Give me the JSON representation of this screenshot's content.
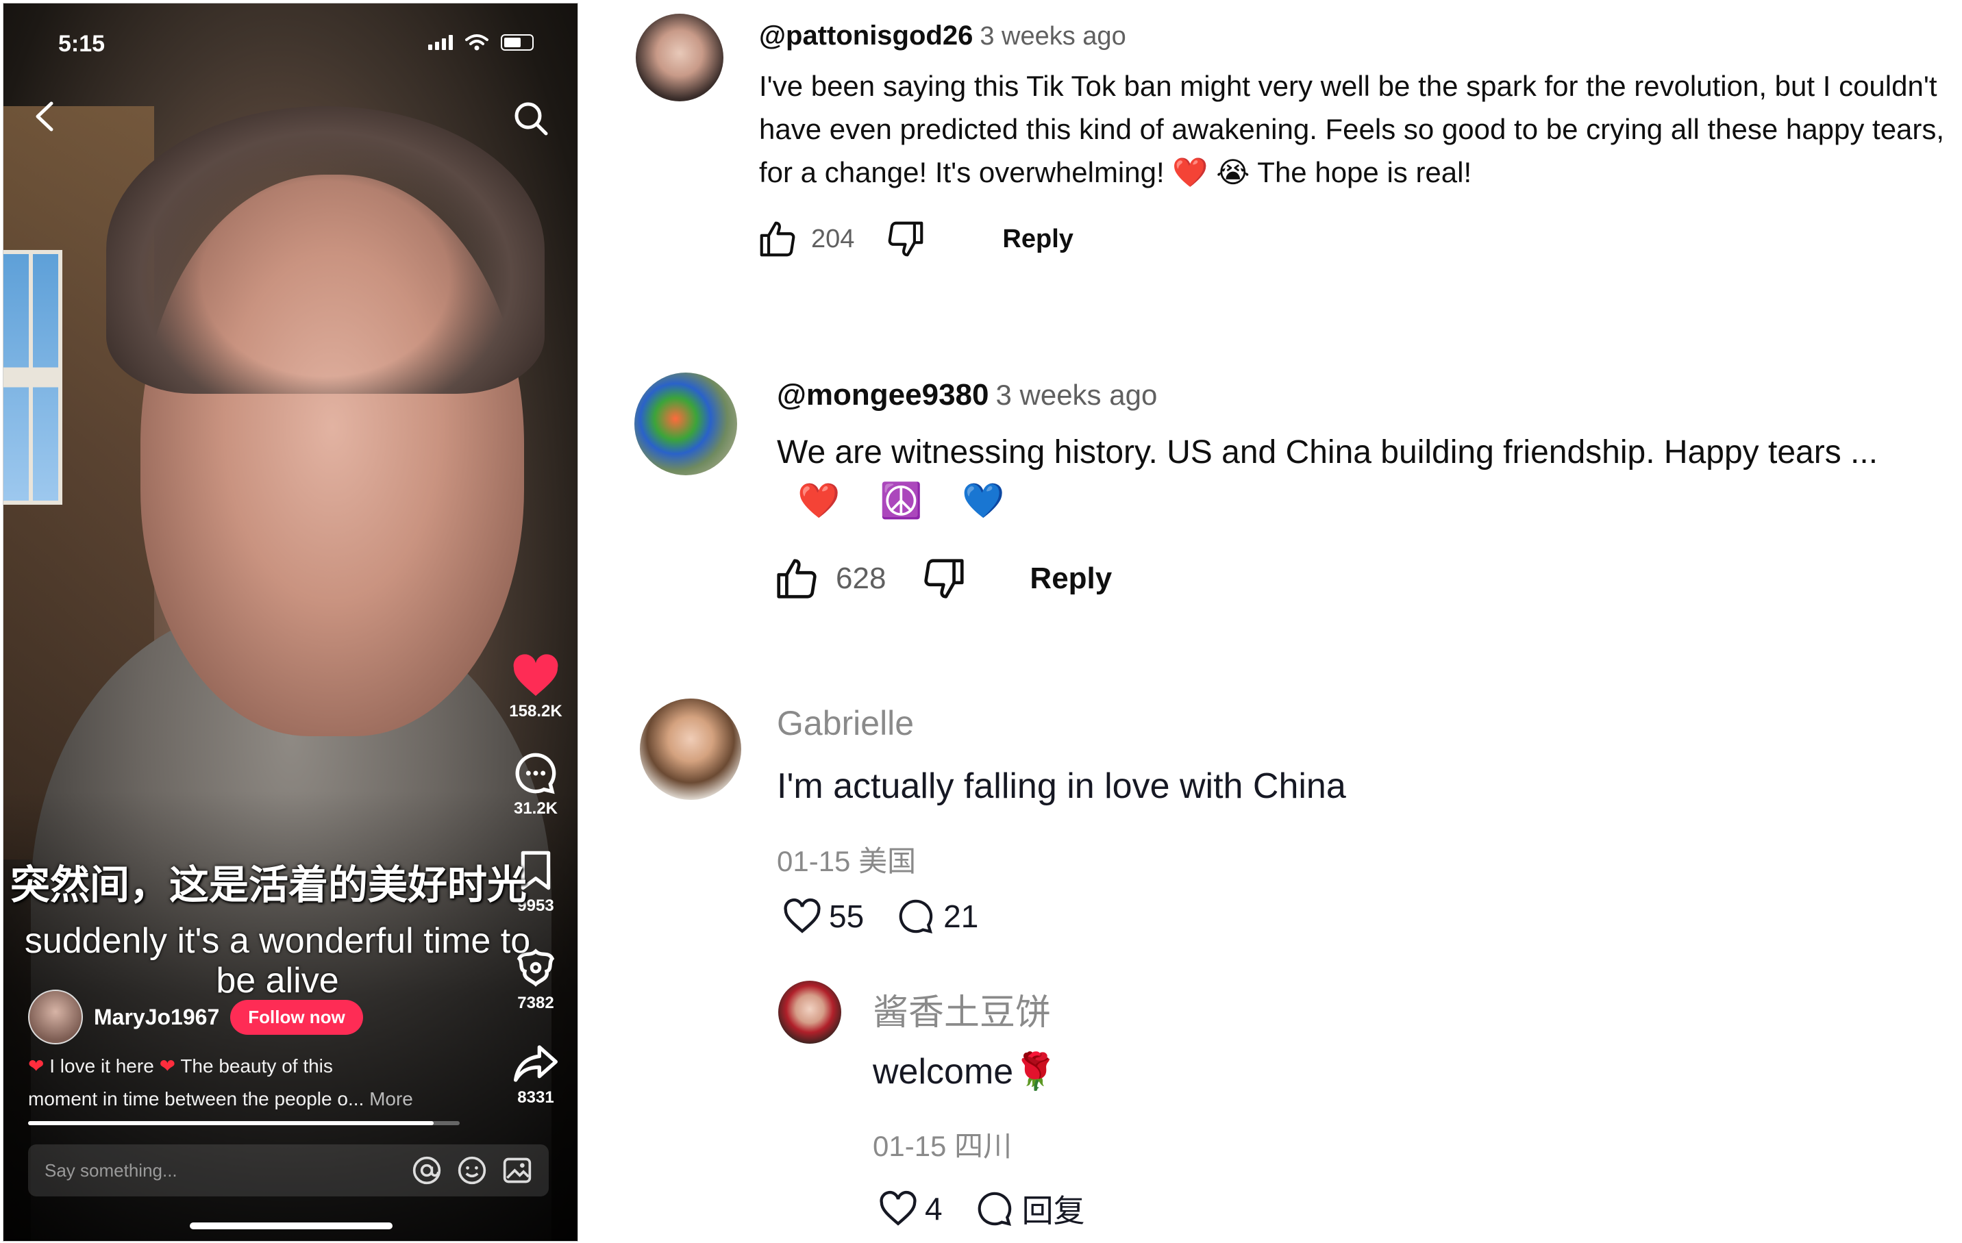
{
  "video": {
    "status_time": "5:15",
    "like_count": "158.2K",
    "comment_count": "31.2K",
    "bookmark_count": "9953",
    "gift_count": "7382",
    "share_count": "8331",
    "caption_cn": "突然间，这是活着的美好时光",
    "caption_en": "suddenly it's a wonderful time to be alive",
    "author": "MaryJo1967",
    "follow_label": "Follow now",
    "description_line1": "I love it here",
    "description_line1b": "The beauty of this",
    "description_line2": "moment in time between the people o...",
    "more_label": "More",
    "input_placeholder": "Say something...",
    "progress": 0.94,
    "icons": [
      "back-arrow",
      "search",
      "heart",
      "comment-bubble",
      "bookmark",
      "gift",
      "share",
      "mention",
      "emoji",
      "image"
    ]
  },
  "comments": [
    {
      "handle": "@pattonisgod26",
      "time": "3 weeks ago",
      "text_before": "I've been saying this Tik Tok ban might very well be the spark for the revolution, but I couldn't have even predicted this kind of awakening. Feels so good to be crying all these happy tears, for a change! It's overwhelming!",
      "emojis": "❤️ 😭",
      "text_after": "The hope is real!",
      "likes": "204",
      "reply_label": "Reply"
    },
    {
      "handle": "@mongee9380",
      "time": "3 weeks ago",
      "text": "We are witnessing history.  US and  China building friendship.  Happy tears ...",
      "emojis": "❤️ ☮️ 💙",
      "likes": "628",
      "reply_label": "Reply"
    }
  ],
  "tt_comments": [
    {
      "name": "Gabrielle",
      "text": "I'm actually falling in love with China",
      "meta": "01-15 美国",
      "likes": "55",
      "replies": "21"
    },
    {
      "name": "酱香土豆饼",
      "text": "welcome",
      "emoji": "🌹",
      "meta": "01-15 四川",
      "likes": "4",
      "reply_label": "回复"
    }
  ],
  "colors": {
    "tiktok_red": "#fe2c55",
    "heart": "#ff2d3d"
  }
}
